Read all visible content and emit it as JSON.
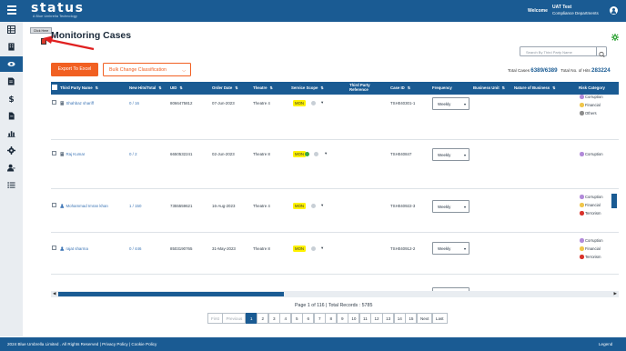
{
  "header": {
    "logo": "status",
    "logo_tagline": "A Blue Umbrella Technology",
    "welcome": "Welcome",
    "user_name": "UAT Test",
    "user_dept": "Compliance Departments"
  },
  "tooltip": "Click Here",
  "page_title": "Monitoring Cases",
  "search": {
    "placeholder": "Search By Third Party Name"
  },
  "toolbar": {
    "export_label": "Export To Excel",
    "bulk_label": "Bulk Change Classification"
  },
  "totals": {
    "cases_label": "Total Cases",
    "cases_value": "6389/6389",
    "hits_label": "Total No. of Hits",
    "hits_value": "283224"
  },
  "table": {
    "columns": [
      "Third Party Name",
      "New Hits/Total",
      "UID",
      "Order Date",
      "Theatre",
      "Service Scope",
      "Third Party Reference",
      "Case ID",
      "Frequency",
      "Business Unit",
      "Nature of Business",
      "Risk Category"
    ],
    "rows": [
      {
        "name": "Shahbaz shariff",
        "entity": "building",
        "hits": "0 / 16",
        "uid": "8066475812",
        "date": "07-Jun-2023",
        "theatre": "Theatre 4",
        "scope": "MON",
        "case_id": "TSH040301-1",
        "frequency": "Weekly",
        "risks": [
          {
            "label": "Corruption",
            "color": "#b28ad9"
          },
          {
            "label": "Financial",
            "color": "#f0c64a"
          },
          {
            "label": "Others",
            "color": "#8c8c8c"
          }
        ]
      },
      {
        "name": "Raj Kumar",
        "entity": "building",
        "hits": "0 / 2",
        "uid": "6650532241",
        "date": "02-Jun-2023",
        "theatre": "Theatre 8",
        "scope": "MON",
        "case_id": "TSH040847",
        "frequency": "Weekly",
        "risks": [
          {
            "label": "Corruption",
            "color": "#b28ad9"
          }
        ]
      },
      {
        "name": "Mohammad Imran khan",
        "entity": "person",
        "hits": "1 / 150",
        "uid": "7355559621",
        "date": "16-Aug-2023",
        "theatre": "Theatre 4",
        "scope": "MON",
        "case_id": "TSH040922-3",
        "frequency": "Weekly",
        "risks": [
          {
            "label": "Corruption",
            "color": "#b28ad9"
          },
          {
            "label": "Financial",
            "color": "#f0c64a"
          },
          {
            "label": "Terrorism",
            "color": "#d9322b"
          }
        ]
      },
      {
        "name": "rajat sharma",
        "entity": "person",
        "hits": "0 / 446",
        "uid": "8503190765",
        "date": "31-May-2023",
        "theatre": "Theatre 8",
        "scope": "MON",
        "case_id": "TSH040912-2",
        "frequency": "Weekly",
        "risks": [
          {
            "label": "Corruption",
            "color": "#b28ad9"
          },
          {
            "label": "Financial",
            "color": "#f0c64a"
          },
          {
            "label": "Terrorism",
            "color": "#d9322b"
          }
        ]
      }
    ]
  },
  "pagination": {
    "info": "Page 1 of 116  |  Total Records : 5785",
    "first": "First",
    "previous": "Previous",
    "pages": [
      "1",
      "2",
      "3",
      "4",
      "5",
      "6",
      "7",
      "8",
      "9",
      "10",
      "11",
      "12",
      "13",
      "14",
      "15"
    ],
    "next": "Next",
    "last": "Last"
  },
  "footer": {
    "copyright": "2024 Blue Umbrella Limited . All Rights Reserved  |  Privacy Policy  |  Cookie Policy",
    "legend": "Legend"
  },
  "colors": {
    "primary": "#1a5b93",
    "accent": "#f16022",
    "scope_highlight": "#fff200"
  }
}
